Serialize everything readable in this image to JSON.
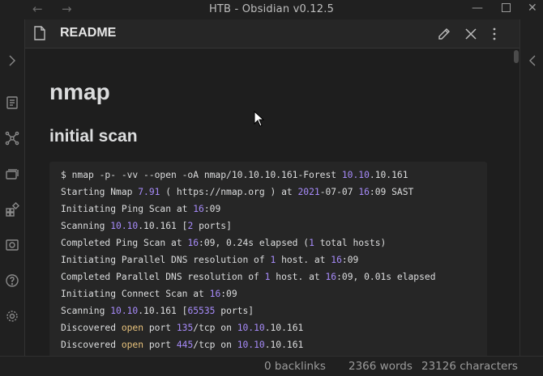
{
  "window": {
    "title": "HTB - Obsidian v0.12.5",
    "back_icon": "arrow-left-icon",
    "forward_icon": "arrow-right-icon",
    "minimize_icon": "minimize-icon",
    "maximize_icon": "maximize-icon",
    "close_icon": "close-icon"
  },
  "ribbon": {
    "items": [
      {
        "icon": "chevron-right-icon"
      },
      {
        "icon": "quick-switcher-icon"
      },
      {
        "icon": "graph-view-icon"
      },
      {
        "icon": "cards-icon"
      },
      {
        "icon": "plugins-icon"
      },
      {
        "icon": "camera-icon"
      },
      {
        "icon": "help-icon"
      },
      {
        "icon": "settings-icon"
      }
    ]
  },
  "pane": {
    "title": "README",
    "actions": [
      "edit-icon",
      "close-icon",
      "more-options-icon"
    ]
  },
  "document": {
    "h1": "nmap",
    "h2": "initial scan",
    "code_lines": [
      [
        [
          "t",
          "$ nmap -p- -vv --open -oA nmap/10.10.10.161-Forest "
        ],
        [
          "n",
          "10.10"
        ],
        [
          "t",
          ".10.161"
        ]
      ],
      [
        [
          "t",
          "Starting Nmap "
        ],
        [
          "n",
          "7.91"
        ],
        [
          "t",
          " ( https://nmap.org ) at "
        ],
        [
          "n",
          "2021"
        ],
        [
          "t",
          "-07-07 "
        ],
        [
          "n",
          "16"
        ],
        [
          "t",
          ":09 SAST"
        ]
      ],
      [
        [
          "t",
          "Initiating Ping Scan at "
        ],
        [
          "n",
          "16"
        ],
        [
          "t",
          ":09"
        ]
      ],
      [
        [
          "t",
          "Scanning "
        ],
        [
          "n",
          "10.10"
        ],
        [
          "t",
          ".10.161 ["
        ],
        [
          "n",
          "2"
        ],
        [
          "t",
          " ports]"
        ]
      ],
      [
        [
          "t",
          "Completed Ping Scan at "
        ],
        [
          "n",
          "16"
        ],
        [
          "t",
          ":09, 0.24s elapsed ("
        ],
        [
          "n",
          "1"
        ],
        [
          "t",
          " total hosts)"
        ]
      ],
      [
        [
          "t",
          "Initiating Parallel DNS resolution of "
        ],
        [
          "n",
          "1"
        ],
        [
          "t",
          " host. at "
        ],
        [
          "n",
          "16"
        ],
        [
          "t",
          ":09"
        ]
      ],
      [
        [
          "t",
          "Completed Parallel DNS resolution of "
        ],
        [
          "n",
          "1"
        ],
        [
          "t",
          " host. at "
        ],
        [
          "n",
          "16"
        ],
        [
          "t",
          ":09, 0.01s elapsed"
        ]
      ],
      [
        [
          "t",
          "Initiating Connect Scan at "
        ],
        [
          "n",
          "16"
        ],
        [
          "t",
          ":09"
        ]
      ],
      [
        [
          "t",
          "Scanning "
        ],
        [
          "n",
          "10.10"
        ],
        [
          "t",
          ".10.161 ["
        ],
        [
          "n",
          "65535"
        ],
        [
          "t",
          " ports]"
        ]
      ],
      [
        [
          "t",
          "Discovered "
        ],
        [
          "k",
          "open"
        ],
        [
          "t",
          " port "
        ],
        [
          "n",
          "135"
        ],
        [
          "t",
          "/tcp on "
        ],
        [
          "n",
          "10.10"
        ],
        [
          "t",
          ".10.161"
        ]
      ],
      [
        [
          "t",
          "Discovered "
        ],
        [
          "k",
          "open"
        ],
        [
          "t",
          " port "
        ],
        [
          "n",
          "445"
        ],
        [
          "t",
          "/tcp on "
        ],
        [
          "n",
          "10.10"
        ],
        [
          "t",
          ".10.161"
        ]
      ]
    ]
  },
  "status": {
    "backlinks": "0 backlinks",
    "words": "2366 words",
    "characters": "23126 characters"
  },
  "colors": {
    "number": "#a78bfa",
    "keyword": "#e5c07b",
    "text": "#dcddde"
  }
}
